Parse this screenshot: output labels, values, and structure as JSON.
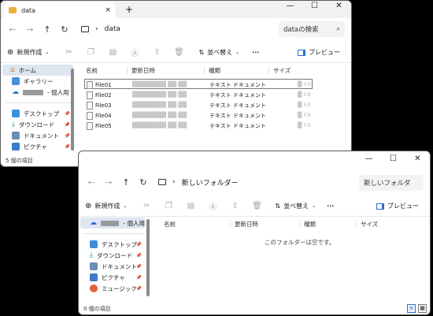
{
  "window1": {
    "tab_title": "data",
    "new_tab": "+",
    "close_tab": "×",
    "controls": {
      "minimize": "—",
      "maximize": "☐",
      "close": "✕"
    },
    "location": "data",
    "search_placeholder": "dataの検索",
    "new_button": "新規作成",
    "sort_button": "並べ替え",
    "more_button": "···",
    "preview_button": "プレビュー",
    "sidebar": [
      {
        "label": "ホーム",
        "icon": "home-icon"
      },
      {
        "label": "ギャラリー",
        "icon": "gallery-icon"
      },
      {
        "label": "- 個人用",
        "icon": "cloud-icon"
      },
      {
        "label": "デスクトップ",
        "icon": "desktop-icon"
      },
      {
        "label": "ダウンロード",
        "icon": "download-icon"
      },
      {
        "label": "ドキュメント",
        "icon": "documents-icon"
      },
      {
        "label": "ピクチャ",
        "icon": "pictures-icon"
      }
    ],
    "columns": {
      "name": "名前",
      "date": "更新日時",
      "type": "種類",
      "size": "サイズ"
    },
    "files": [
      {
        "name": "File01",
        "type": "テキスト ドキュメント"
      },
      {
        "name": "File02",
        "type": "テキスト ドキュメント"
      },
      {
        "name": "File03",
        "type": "テキスト ドキュメント"
      },
      {
        "name": "File04",
        "type": "テキスト ドキュメント"
      },
      {
        "name": "File05",
        "type": "テキスト ドキュメント"
      }
    ],
    "status": "5 個の項目"
  },
  "window2": {
    "controls": {
      "minimize": "—",
      "maximize": "☐",
      "close": "✕"
    },
    "location": "新しいフォルダー",
    "search_placeholder": "新しいフォルダ",
    "new_button": "新規作成",
    "sort_button": "並べ替え",
    "more_button": "···",
    "preview_button": "プレビュー",
    "sidebar": [
      {
        "label": "- 個人用",
        "icon": "cloud-icon"
      },
      {
        "label": "デスクトップ",
        "icon": "desktop-icon"
      },
      {
        "label": "ダウンロード",
        "icon": "download-icon"
      },
      {
        "label": "ドキュメント",
        "icon": "documents-icon"
      },
      {
        "label": "ピクチャ",
        "icon": "pictures-icon"
      },
      {
        "label": "ミュージック",
        "icon": "music-icon"
      }
    ],
    "columns": {
      "name": "名前",
      "date": "更新日時",
      "type": "種類",
      "size": "サイズ"
    },
    "empty_message": "このフォルダーは空です。",
    "status": "0 個の項目"
  },
  "colors": {
    "accent": "#2b6fd1",
    "selection": "#dde6f1",
    "folder": "#e8b33a",
    "background": "#000000"
  }
}
